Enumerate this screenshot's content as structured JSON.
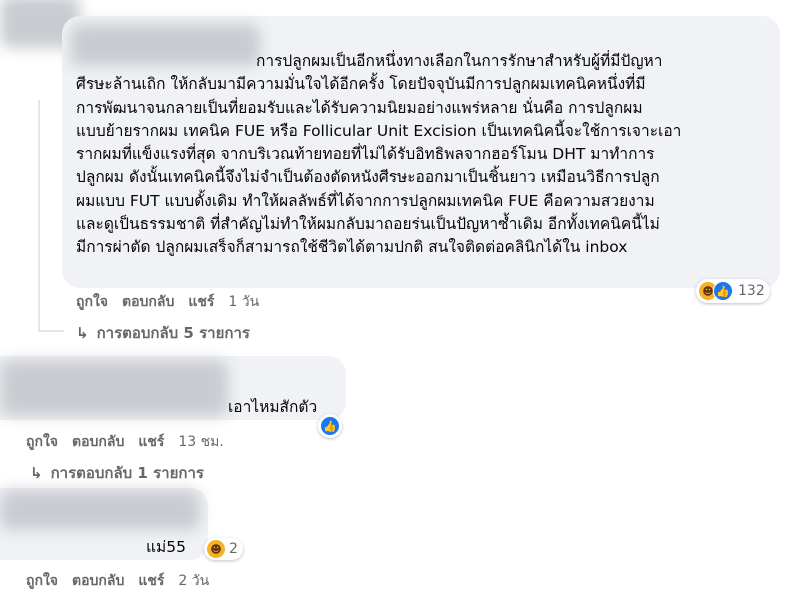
{
  "comments": [
    {
      "lines": [
        "การปลูกผมเป็นอีกหนึ่งทางเลือกในการรักษาสำหรับผู้ที่มีปัญหา",
        "ศีรษะล้านเถิก ให้กลับมามีความมั่นใจได้อีกครั้ง โดยปัจจุบันมีการปลูกผมเทคนิคหนึ่งที่มี",
        "การพัฒนาจนกลายเป็นที่ยอมรับและได้รับความนิยมอย่างแพร่หลาย นั่นคือ การปลูกผม",
        "แบบย้ายรากผม เทคนิค FUE หรือ Follicular Unit Excision เป็นเทคนิคนี้จะใช้การเจาะเอา",
        "รากผมที่แข็งแรงที่สุด จากบริเวณท้ายทอยที่ไม่ได้รับอิทธิพลจากฮอร์โมน DHT มาทำการ",
        "ปลูกผม ดังนั้นเทคนิคนี้จึงไม่จำเป็นต้องตัดหนังศีรษะออกมาเป็นชิ้นยาว เหมือนวิธีการปลูก",
        "ผมแบบ FUT แบบดั้งเดิม ทำให้ผลลัพธ์ที่ได้จากการปลูกผมเทคนิค FUE คือความสวยงาม",
        "และดูเป็นธรรมชาติ ที่สำคัญไม่ทำให้ผมกลับมาถอยร่นเป็นปัญหาซ้ำเดิม อีกทั้งเทคนิคนี้ไม่",
        "มีการผ่าตัด ปลูกผมเสร็จก็สามารถใช้ชีวิตได้ตามปกติ สนใจติดต่อคลินิกได้ใน inbox"
      ],
      "reaction_count": "132",
      "like": "ถูกใจ",
      "reply": "ตอบกลับ",
      "share": "แชร์",
      "time": "1 วัน",
      "replies_label": "การตอบกลับ 5 รายการ"
    },
    {
      "text": "เอาไหมสักตัว",
      "like": "ถูกใจ",
      "reply": "ตอบกลับ",
      "share": "แชร์",
      "time": "13 ชม.",
      "replies_label": "การตอบกลับ 1 รายการ"
    },
    {
      "text": "แม่55",
      "reaction_count": "2",
      "like": "ถูกใจ",
      "reply": "ตอบกลับ",
      "share": "แชร์",
      "time": "2 วัน"
    }
  ],
  "icons": {
    "haha": "haha-emoji-icon",
    "like": "like-emoji-icon",
    "reply_arrow": "reply-arrow-icon"
  }
}
